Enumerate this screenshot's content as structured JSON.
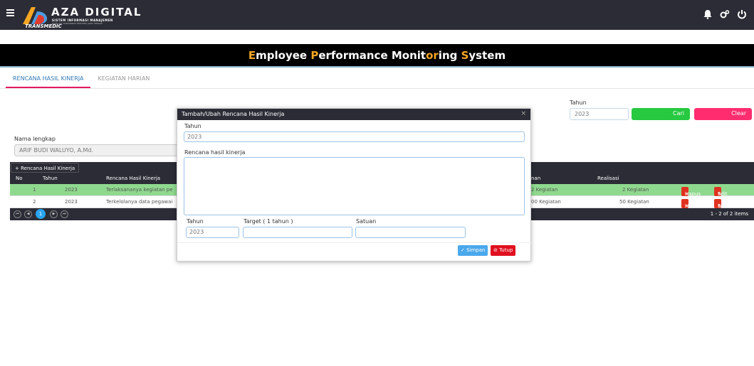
{
  "header": {
    "brand_title": "AZA DIGITAL",
    "brand_subtitle": "SISTEM INFORMASI MANAJEMEN",
    "brand_caption": "RSUD DR. SOEWONDO PROVINSI JAWA TENGAH",
    "brand_under": "TRANSMEDIC",
    "icons": [
      "bell-icon",
      "cogs-icon",
      "power-icon"
    ]
  },
  "title": {
    "parts": [
      {
        "text": "E",
        "hl": true
      },
      {
        "text": "mployee ",
        "hl": false
      },
      {
        "text": "P",
        "hl": true
      },
      {
        "text": "erformance ",
        "hl": false
      },
      {
        "text": "Monit",
        "hl": false
      },
      {
        "text": "or",
        "hl": true
      },
      {
        "text": "ing ",
        "hl": false
      },
      {
        "text": "S",
        "hl": true
      },
      {
        "text": "ystem",
        "hl": false
      }
    ]
  },
  "tabs": {
    "tab1": "RENCANA HASIL KINERJA",
    "tab2": "KEGIATAN HARIAN"
  },
  "filter": {
    "tahun_label": "Tahun",
    "tahun_value": "2023",
    "cari_label": "Cari",
    "clear_label": "Clear",
    "nama_label": "Nama lengkap",
    "nama_value": "ARIF BUDI WALUYO, A.Md."
  },
  "grid": {
    "add_label": "Rencana Hasil Kinerja",
    "headers": {
      "no": "No",
      "tahun": "Tahun",
      "rencana": "Rencana Hasil Kinerja",
      "target": "nan",
      "realisasi": "Realisasi"
    },
    "rows": [
      {
        "no": "1",
        "tahun": "2023",
        "rencana": "Terlaksananya kegiatan pe",
        "target": "2 Kegiatan",
        "realisasi": "2 Kegiatan"
      },
      {
        "no": "2",
        "tahun": "2023",
        "rencana": "Terkelolanya data pegawai",
        "target": "00 Kegiatan",
        "realisasi": "50 Kegiatan"
      }
    ],
    "hapus_label": "Hapus",
    "edit_label": "Edit",
    "current_page": "1",
    "page_info": "1 - 2 of 2 items"
  },
  "modal": {
    "title": "Tambah/Ubah Rencana Hasil Kinerja",
    "close": "×",
    "tahun_label": "Tahun",
    "tahun_value": "2023",
    "rencana_label": "Rencana hasil kinerja",
    "tahun2_label": "Tahun",
    "tahun2_value": "2023",
    "target_label": "Target ( 1 tahun )",
    "satuan_label": "Satuan",
    "simpan_label": "Simpan",
    "tutup_label": "Tutup"
  },
  "colors": {
    "topbar": "#2b2c36",
    "accent_orange": "#f5a623",
    "cari_green": "#26c940",
    "clear_pink": "#ff2d6f",
    "row_green": "#8fd98f",
    "danger_red": "#e0321f",
    "simpan_blue": "#4aa8ec"
  }
}
